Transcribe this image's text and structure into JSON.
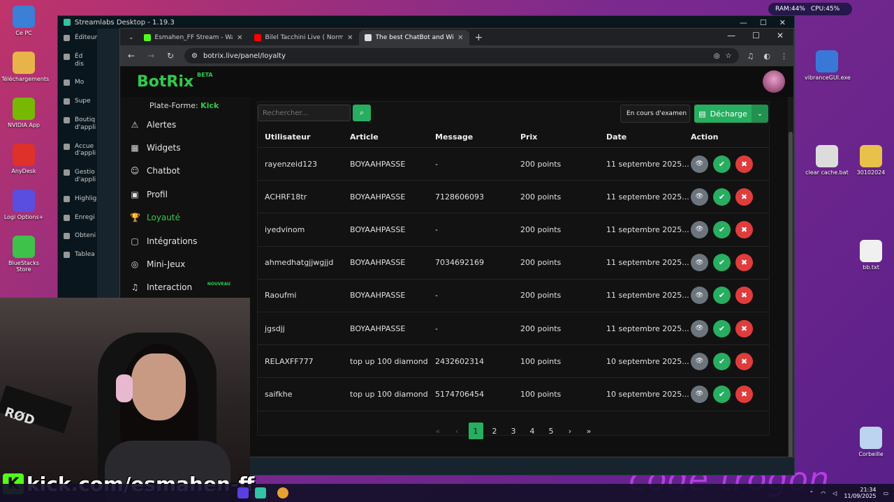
{
  "desktop": {
    "icons_left": [
      {
        "label": "Ce PC",
        "color": "#3b7fd6"
      },
      {
        "label": "Téléchargements",
        "color": "#e8b44a"
      },
      {
        "label": "NVIDIA App",
        "color": "#76b900"
      },
      {
        "label": "AnyDesk",
        "color": "#e0302a"
      },
      {
        "label": "Logi Options+",
        "color": "#5a4ee0"
      },
      {
        "label": "BlueStacks Store",
        "color": "#3fc24a"
      }
    ],
    "icons_right": [
      {
        "label": "vibranceGUI.exe",
        "color": "#3a78d8"
      },
      {
        "label": "clear cache.bat",
        "color": "#dcdcdc"
      },
      {
        "label": "30102024",
        "color": "#e8c14a"
      },
      {
        "label": "bb.txt",
        "color": "#f0f0f0"
      },
      {
        "label": "Corbeille",
        "color": "#bcd4f0"
      }
    ],
    "sysmon": {
      "ram": "RAM:44%",
      "cpu": "CPU:45%"
    },
    "watermark": "code trogon"
  },
  "streamlabs": {
    "title": "Streamlabs Desktop - 1.19.3",
    "sidebar": [
      "Éditeur",
      "Éd dis",
      "Mo",
      "Supe",
      "Boutiq d'appli",
      "Accue d'appli",
      "Gestio d'appli",
      "Highlig",
      "Enregi",
      "Obteni",
      "Tablea"
    ]
  },
  "browser": {
    "tabs": [
      {
        "title": "Esmahen_FF Stream - Watch Li",
        "color": "#53fc18",
        "active": false
      },
      {
        "title": "Bilel Tacchini Live ( Normal",
        "color": "#ff0000",
        "active": false
      },
      {
        "title": "The best ChatBot and Widgets",
        "color": "#dddddd",
        "active": true
      }
    ],
    "url": "botrix.live/panel/loyalty",
    "new_tab": "+"
  },
  "app": {
    "brand": "BotRix",
    "beta": "BETA",
    "platform_label": "Plate-Forme:",
    "platform_value": "Kick",
    "nav": [
      {
        "label": "Alertes",
        "icon": "⚠",
        "name": "alerts"
      },
      {
        "label": "Widgets",
        "icon": "▦",
        "name": "widgets"
      },
      {
        "label": "Chatbot",
        "icon": "☺",
        "name": "chatbot"
      },
      {
        "label": "Profil",
        "icon": "▣",
        "name": "profile"
      },
      {
        "label": "Loyauté",
        "icon": "🏆",
        "name": "loyalty",
        "active": true
      },
      {
        "label": "Intégrations",
        "icon": "▢",
        "name": "integrations"
      },
      {
        "label": "Mini-Jeux",
        "icon": "◎",
        "name": "mini-games"
      },
      {
        "label": "Interaction",
        "icon": "♫",
        "name": "interaction",
        "badge": "NOUVEAU"
      }
    ]
  },
  "toolbar": {
    "search_placeholder": "Rechercher...",
    "status": "En cours d'examen",
    "download": "Décharge"
  },
  "table": {
    "headers": {
      "user": "Utilisateur",
      "article": "Article",
      "message": "Message",
      "price": "Prix",
      "date": "Date",
      "action": "Action"
    },
    "rows": [
      {
        "user": "rayenzeid123",
        "article": "BOYAAHPASSE",
        "message": "-",
        "price": "200 points",
        "date": "11 septembre 2025..."
      },
      {
        "user": "ACHRF18tr",
        "article": "BOYAAHPASSE",
        "message": "7128606093",
        "price": "200 points",
        "date": "11 septembre 2025..."
      },
      {
        "user": "iyedvinom",
        "article": "BOYAAHPASSE",
        "message": "-",
        "price": "200 points",
        "date": "11 septembre 2025..."
      },
      {
        "user": "ahmedhatgjjwgjjd",
        "article": "BOYAAHPASSE",
        "message": "7034692169",
        "price": "200 points",
        "date": "11 septembre 2025..."
      },
      {
        "user": "Raoufmi",
        "article": "BOYAAHPASSE",
        "message": "-",
        "price": "200 points",
        "date": "11 septembre 2025..."
      },
      {
        "user": "jgsdjj",
        "article": "BOYAAHPASSE",
        "message": "-",
        "price": "200 points",
        "date": "11 septembre 2025..."
      },
      {
        "user": "RELAXFF777",
        "article": "top up 100 diamond",
        "message": "2432602314",
        "price": "100 points",
        "date": "10 septembre 2025..."
      },
      {
        "user": "saifkhe",
        "article": "top up 100 diamond",
        "message": "5174706454",
        "price": "100 points",
        "date": "10 septembre 2025..."
      }
    ]
  },
  "pagination": {
    "first": "«",
    "prev": "‹",
    "pages": [
      "1",
      "2",
      "3",
      "4",
      "5"
    ],
    "current": "1",
    "next": "›",
    "last": "»"
  },
  "overlay": {
    "kick_letter": "K",
    "kick_url": "kick.com/esmahen-ff",
    "mic_label": "RØD"
  },
  "taskbar": {
    "time": "21:34",
    "date": "11/09/2025"
  },
  "colors": {
    "accent_green": "#2ecc4a",
    "button_green": "#27ae60",
    "danger_red": "#e03c3c",
    "neutral_grey": "#6c757d"
  }
}
